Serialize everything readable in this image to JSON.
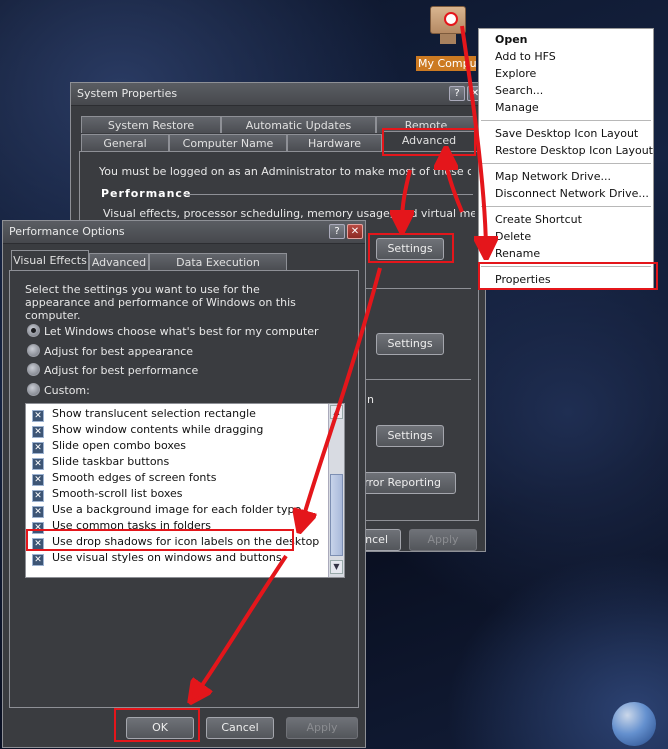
{
  "desktop_icon": {
    "label": "My Computer"
  },
  "context_menu": {
    "items": [
      "Open",
      "Add to HFS",
      "Explore",
      "Search...",
      "Manage",
      "",
      "Save Desktop Icon Layout",
      "Restore Desktop Icon Layout",
      "",
      "Map Network Drive...",
      "Disconnect Network Drive...",
      "",
      "Create Shortcut",
      "Delete",
      "Rename",
      "",
      "Properties"
    ]
  },
  "system_properties": {
    "title": "System Properties",
    "tabs_back": [
      "System Restore",
      "Automatic Updates",
      "Remote"
    ],
    "tabs_front": [
      "General",
      "Computer Name",
      "Hardware",
      "Advanced"
    ],
    "admin_note": "You must be logged on as an Administrator to make most of these changes.",
    "performance_label": "Performance",
    "performance_desc": "Visual effects, processor scheduling, memory usage, and virtual memory",
    "settings_label": "Settings",
    "startup_fragment": "n",
    "error_reporting": "Error Reporting",
    "cancel": "Cancel",
    "apply": "Apply"
  },
  "performance_options": {
    "title": "Performance Options",
    "tabs": [
      "Visual Effects",
      "Advanced",
      "Data Execution Prevention"
    ],
    "intro": "Select the settings you want to use for the appearance and performance of Windows on this computer.",
    "radios": [
      "Let Windows choose what's best for my computer",
      "Adjust for best appearance",
      "Adjust for best performance",
      "Custom:"
    ],
    "effects": [
      "Show translucent selection rectangle",
      "Show window contents while dragging",
      "Slide open combo boxes",
      "Slide taskbar buttons",
      "Smooth edges of screen fonts",
      "Smooth-scroll list boxes",
      "Use a background image for each folder type",
      "Use common tasks in folders",
      "Use drop shadows for icon labels on the desktop",
      "Use visual styles on windows and buttons"
    ],
    "ok": "OK",
    "cancel": "Cancel",
    "apply": "Apply"
  },
  "colors": {
    "highlight": "#e4161b",
    "window_bg": "#3a3c40"
  }
}
